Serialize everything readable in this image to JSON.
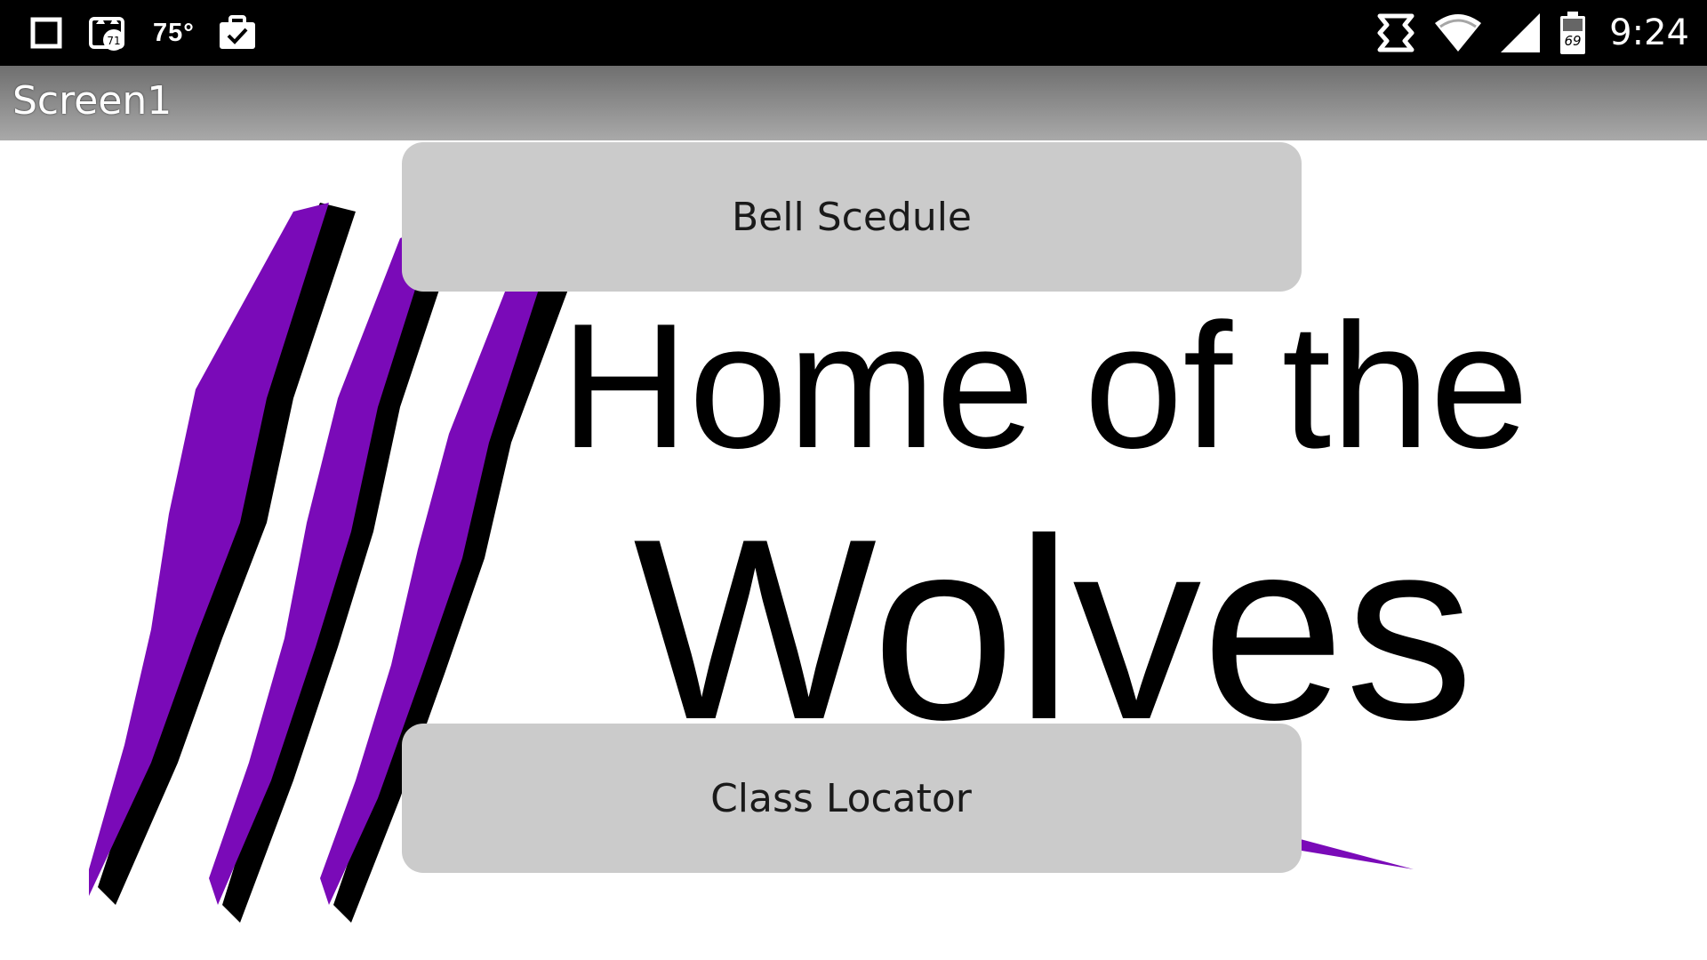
{
  "status_bar": {
    "left_icons": [
      "square-icon",
      "cat-notification-icon",
      "temperature",
      "briefcase-check-icon"
    ],
    "cat_badge": "71",
    "temperature": "75°",
    "right_icons": [
      "sync-icon",
      "wifi-icon",
      "cell-signal-icon",
      "battery-icon"
    ],
    "battery_level": "69",
    "time": "9:24"
  },
  "title_bar": {
    "title": "Screen1"
  },
  "logo": {
    "line1": "Home of the",
    "line2": "Wolves",
    "accent_color": "#7a0ab8"
  },
  "buttons": {
    "bell_schedule": "Bell Scedule",
    "class_locator": "Class Locator"
  },
  "colors": {
    "status_bar": "#000000",
    "title_bar": "#8e8e8e",
    "button": "#cbcbcb",
    "claw_purple": "#7a0ab8"
  }
}
